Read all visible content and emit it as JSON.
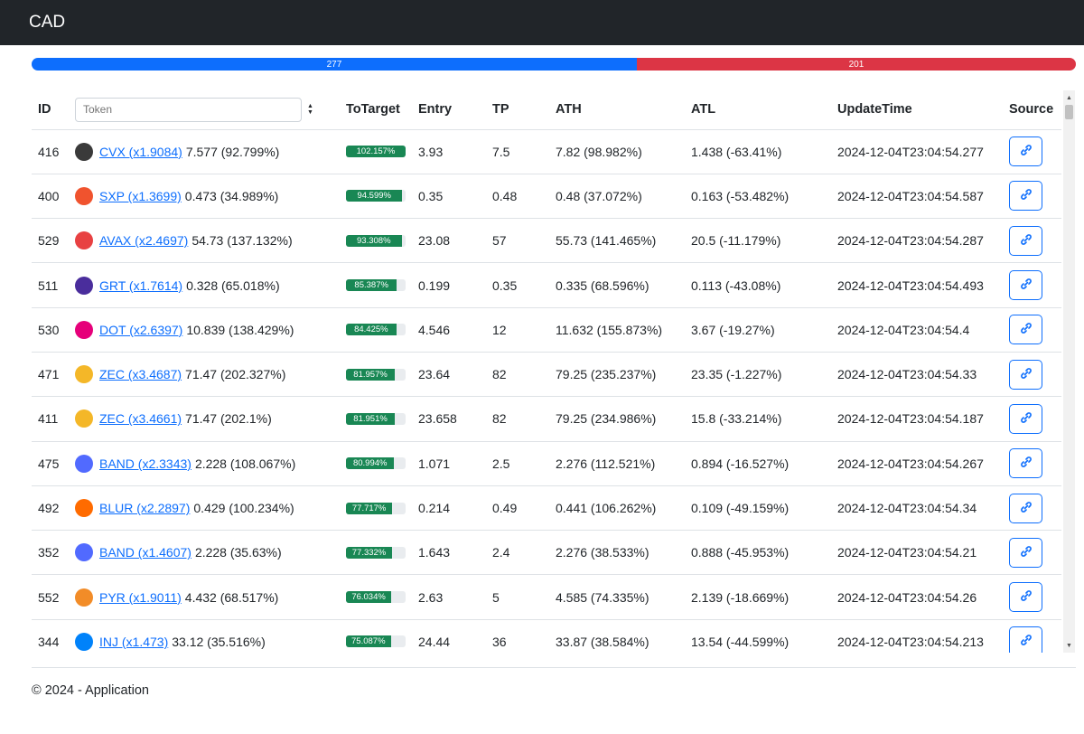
{
  "app": {
    "title": "CAD"
  },
  "progress": {
    "up_count": "277",
    "down_count": "201",
    "up_fraction": 0.5795,
    "up_color": "#0d6efd",
    "down_color": "#dc3545"
  },
  "table": {
    "headers": {
      "id": "ID",
      "token_placeholder": "Token",
      "to_target": "ToTarget",
      "entry": "Entry",
      "tp": "TP",
      "ath": "ATH",
      "atl": "ATL",
      "update_time": "UpdateTime",
      "source": "Source"
    },
    "rows": [
      {
        "id": "416",
        "token": "CVX (x1.9084)",
        "price": " 7.577 (92.799%)",
        "icon": "cvx-icon",
        "icon_color": "#3a3a3a",
        "to_target": "102.157%",
        "to_target_value": 1.0,
        "entry": "3.93",
        "tp": "7.5",
        "ath": "7.82 (98.982%)",
        "atl": "1.438 (-63.41%)",
        "update": "2024-12-04T23:04:54.277"
      },
      {
        "id": "400",
        "token": "SXP (x1.3699)",
        "price": " 0.473 (34.989%)",
        "icon": "sxp-icon",
        "icon_color": "#f0532e",
        "to_target": "94.599%",
        "to_target_value": 0.946,
        "entry": "0.35",
        "tp": "0.48",
        "ath": "0.48 (37.072%)",
        "atl": "0.163 (-53.482%)",
        "update": "2024-12-04T23:04:54.587"
      },
      {
        "id": "529",
        "token": "AVAX (x2.4697)",
        "price": " 54.73 (137.132%)",
        "icon": "avax-icon",
        "icon_color": "#e84142",
        "to_target": "93.308%",
        "to_target_value": 0.933,
        "entry": "23.08",
        "tp": "57",
        "ath": "55.73 (141.465%)",
        "atl": "20.5 (-11.179%)",
        "update": "2024-12-04T23:04:54.287"
      },
      {
        "id": "511",
        "token": "GRT (x1.7614)",
        "price": " 0.328 (65.018%)",
        "icon": "grt-icon",
        "icon_color": "#4a2d9c",
        "to_target": "85.387%",
        "to_target_value": 0.854,
        "entry": "0.199",
        "tp": "0.35",
        "ath": "0.335 (68.596%)",
        "atl": "0.113 (-43.08%)",
        "update": "2024-12-04T23:04:54.493"
      },
      {
        "id": "530",
        "token": "DOT (x2.6397)",
        "price": " 10.839 (138.429%)",
        "icon": "dot-icon",
        "icon_color": "#e6007a",
        "to_target": "84.425%",
        "to_target_value": 0.844,
        "entry": "4.546",
        "tp": "12",
        "ath": "11.632 (155.873%)",
        "atl": "3.67 (-19.27%)",
        "update": "2024-12-04T23:04:54.4"
      },
      {
        "id": "471",
        "token": "ZEC (x3.4687)",
        "price": " 71.47 (202.327%)",
        "icon": "zec-icon",
        "icon_color": "#f4b728",
        "to_target": "81.957%",
        "to_target_value": 0.82,
        "entry": "23.64",
        "tp": "82",
        "ath": "79.25 (235.237%)",
        "atl": "23.35 (-1.227%)",
        "update": "2024-12-04T23:04:54.33"
      },
      {
        "id": "411",
        "token": "ZEC (x3.4661)",
        "price": " 71.47 (202.1%)",
        "icon": "zec-icon",
        "icon_color": "#f4b728",
        "to_target": "81.951%",
        "to_target_value": 0.82,
        "entry": "23.658",
        "tp": "82",
        "ath": "79.25 (234.986%)",
        "atl": "15.8 (-33.214%)",
        "update": "2024-12-04T23:04:54.187"
      },
      {
        "id": "475",
        "token": "BAND (x2.3343)",
        "price": " 2.228 (108.067%)",
        "icon": "band-icon",
        "icon_color": "#516aff",
        "to_target": "80.994%",
        "to_target_value": 0.81,
        "entry": "1.071",
        "tp": "2.5",
        "ath": "2.276 (112.521%)",
        "atl": "0.894 (-16.527%)",
        "update": "2024-12-04T23:04:54.267"
      },
      {
        "id": "492",
        "token": "BLUR (x2.2897)",
        "price": " 0.429 (100.234%)",
        "icon": "blur-icon",
        "icon_color": "#ff6b00",
        "to_target": "77.717%",
        "to_target_value": 0.777,
        "entry": "0.214",
        "tp": "0.49",
        "ath": "0.441 (106.262%)",
        "atl": "0.109 (-49.159%)",
        "update": "2024-12-04T23:04:54.34"
      },
      {
        "id": "352",
        "token": "BAND (x1.4607)",
        "price": " 2.228 (35.63%)",
        "icon": "band-icon",
        "icon_color": "#516aff",
        "to_target": "77.332%",
        "to_target_value": 0.773,
        "entry": "1.643",
        "tp": "2.4",
        "ath": "2.276 (38.533%)",
        "atl": "0.888 (-45.953%)",
        "update": "2024-12-04T23:04:54.21"
      },
      {
        "id": "552",
        "token": "PYR (x1.9011)",
        "price": " 4.432 (68.517%)",
        "icon": "pyr-icon",
        "icon_color": "#f28c28",
        "to_target": "76.034%",
        "to_target_value": 0.76,
        "entry": "2.63",
        "tp": "5",
        "ath": "4.585 (74.335%)",
        "atl": "2.139 (-18.669%)",
        "update": "2024-12-04T23:04:54.26"
      },
      {
        "id": "344",
        "token": "INJ (x1.473)",
        "price": " 33.12 (35.516%)",
        "icon": "inj-icon",
        "icon_color": "#0082fa",
        "to_target": "75.087%",
        "to_target_value": 0.751,
        "entry": "24.44",
        "tp": "36",
        "ath": "33.87 (38.584%)",
        "atl": "13.54 (-44.599%)",
        "update": "2024-12-04T23:04:54.213"
      }
    ]
  },
  "footer": {
    "text": "© 2024 - Application"
  }
}
